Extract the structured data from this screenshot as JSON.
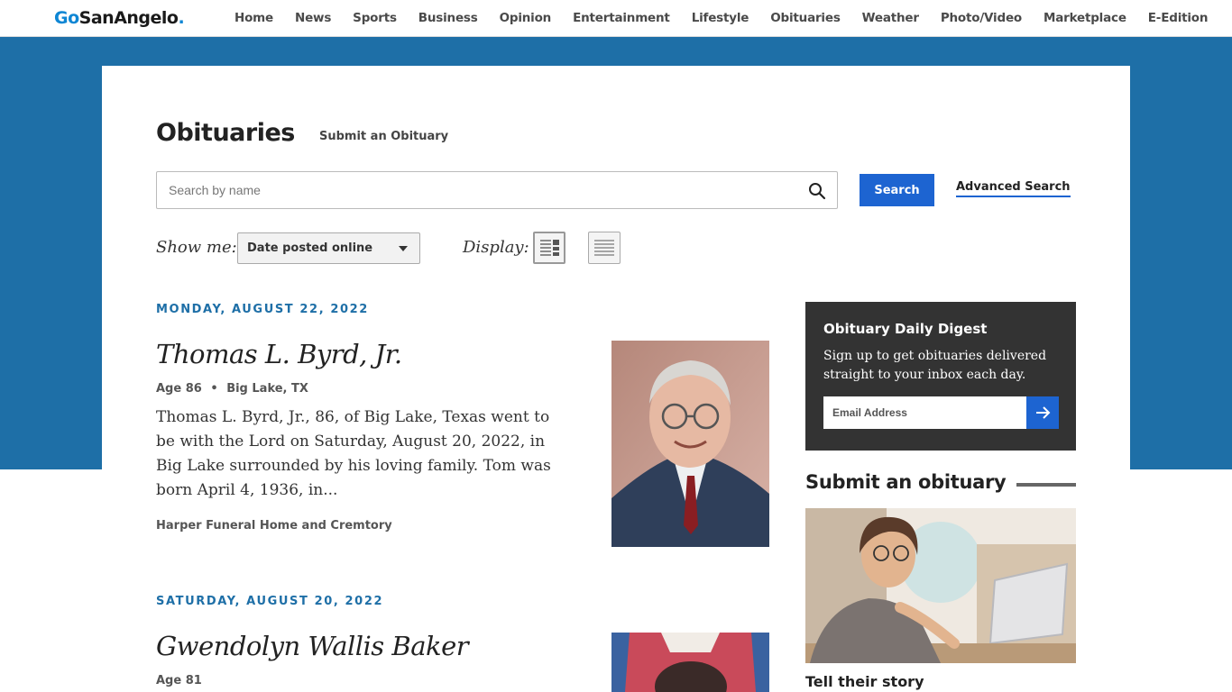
{
  "site": {
    "logo_go": "Go",
    "logo_rest": "SanAngelo",
    "logo_dot": "."
  },
  "nav": {
    "items": [
      "Home",
      "News",
      "Sports",
      "Business",
      "Opinion",
      "Entertainment",
      "Lifestyle",
      "Obituaries",
      "Weather",
      "Photo/Video",
      "Marketplace",
      "E-Edition"
    ]
  },
  "header": {
    "title": "Obituaries",
    "submit_link": "Submit an Obituary"
  },
  "search": {
    "placeholder": "Search by name",
    "value": "",
    "button": "Search",
    "advanced": "Advanced Search"
  },
  "filters": {
    "show_me_label": "Show me:",
    "sort_value": "Date posted online",
    "display_label": "Display:"
  },
  "obituaries": [
    {
      "date": "MONDAY, AUGUST 22, 2022",
      "name": "Thomas L. Byrd, Jr.",
      "age": "Age 86",
      "separator": "•",
      "location": "Big Lake, TX",
      "excerpt": "Thomas L. Byrd, Jr., 86, of Big Lake, Texas went to be with the Lord on Saturday, August 20, 2022, in Big Lake surrounded by his loving family. Tom was born April 4, 1936, in...",
      "funeral_home": "Harper Funeral Home and Cremtory"
    },
    {
      "date": "SATURDAY, AUGUST 20, 2022",
      "name": "Gwendolyn Wallis Baker",
      "age": "Age 81"
    }
  ],
  "sidebar": {
    "digest_title": "Obituary Daily Digest",
    "digest_text": "Sign up to get obituaries delivered straight to your inbox each day.",
    "email_placeholder": "Email Address",
    "submit_title": "Submit an obituary",
    "tell_title": "Tell their story"
  },
  "colors": {
    "brand_blue": "#1e6fa7",
    "button_blue": "#1d64d1",
    "digest_bg": "#333333"
  }
}
